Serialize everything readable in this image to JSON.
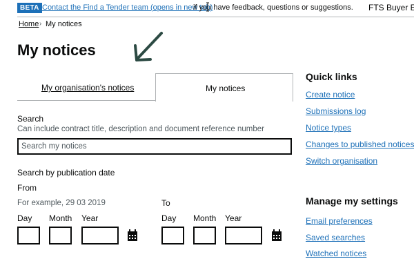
{
  "banner": {
    "tag": "BETA",
    "link_text": "Contact the Find a Tender team (opens in new tab)",
    "rest_text": "if you have feedback, questions or suggestions.",
    "brand_partial": "FTS Buyer Ex"
  },
  "breadcrumb": {
    "home": "Home",
    "separator": "›",
    "current": "My notices"
  },
  "page_title": "My notices",
  "tabs": [
    {
      "label": "My organisation's notices",
      "selected": false
    },
    {
      "label": "My notices",
      "selected": true
    }
  ],
  "search": {
    "label": "Search",
    "hint": "Can include contract title, description and document reference number",
    "placeholder": "Search my notices"
  },
  "publication_date": {
    "label": "Search by publication date",
    "from_label": "From",
    "hint": "For example, 29 03 2019",
    "to_label": "To",
    "day_label": "Day",
    "month_label": "Month",
    "year_label": "Year"
  },
  "quick_links": {
    "title": "Quick links",
    "items": [
      "Create notice",
      "Submissions log",
      "Notice types",
      "Changes to published notices",
      "Switch organisation"
    ]
  },
  "settings": {
    "title": "Manage my settings",
    "items": [
      "Email preferences",
      "Saved searches",
      "Watched notices"
    ]
  },
  "colors": {
    "link": "#1d70b8",
    "beta_tag": "#1d70b8",
    "text": "#0b0c0c",
    "arrow": "#2c4a43"
  },
  "icons": [
    "calendar-icon",
    "arrow-annotation-icon",
    "mouse-cursor-icon"
  ]
}
